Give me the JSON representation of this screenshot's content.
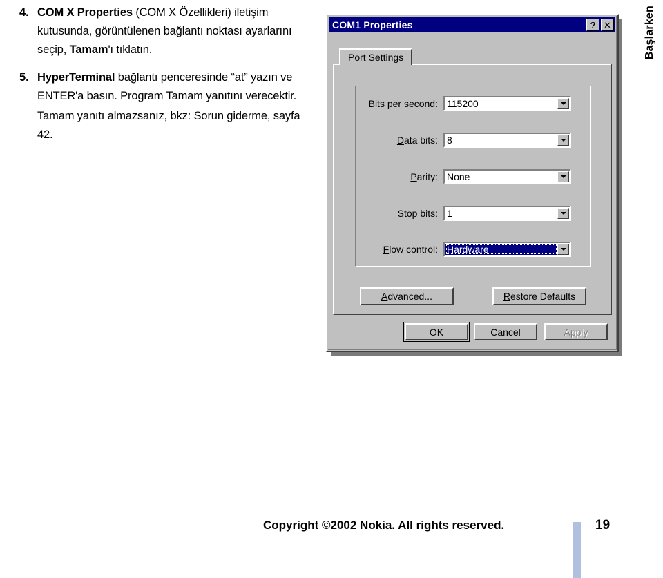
{
  "document": {
    "side_tab_label": "Başlarken",
    "steps": [
      {
        "number": "4.",
        "segments": [
          {
            "text": "COM X Properties",
            "bold": true
          },
          {
            "text": " (COM X Özellikleri) iletişim kutusunda, görüntülenen bağlantı noktası ayarlarını seçip, ",
            "bold": false
          },
          {
            "text": "Tamam",
            "bold": true
          },
          {
            "text": "'ı tıklatın.",
            "bold": false
          }
        ]
      },
      {
        "number": "5.",
        "segments": [
          {
            "text": "HyperTerminal",
            "bold": true
          },
          {
            "text": " bağlantı penceresinde “at” yazın ve ENTER'a basın. Program Tamam yanıtını verecektir.",
            "bold": false
          }
        ],
        "sub_paragraph": "Tamam yanıtı almazsanız, bkz: Sorun giderme, sayfa 42."
      }
    ]
  },
  "dialog": {
    "title": "COM1 Properties",
    "titlebar_buttons": [
      {
        "name": "help-button",
        "glyph": "?"
      },
      {
        "name": "close-button",
        "glyph": "✕"
      }
    ],
    "tabs": [
      {
        "label": "Port Settings",
        "active": true
      }
    ],
    "fields": [
      {
        "label_prefix": "",
        "label_accel": "B",
        "label_rest": "its per second:",
        "value": "115200",
        "selected": false
      },
      {
        "label_prefix": "",
        "label_accel": "D",
        "label_rest": "ata bits:",
        "value": "8",
        "selected": false
      },
      {
        "label_prefix": "",
        "label_accel": "P",
        "label_rest": "arity:",
        "value": "None",
        "selected": false
      },
      {
        "label_prefix": "",
        "label_accel": "S",
        "label_rest": "top bits:",
        "value": "1",
        "selected": false
      },
      {
        "label_prefix": "",
        "label_accel": "F",
        "label_rest": "low control:",
        "value": "Hardware",
        "selected": true
      }
    ],
    "page_buttons": {
      "advanced": {
        "accel": "A",
        "prefix": "",
        "rest": "dvanced..."
      },
      "restore": {
        "accel": "R",
        "prefix": "",
        "rest": "estore Defaults"
      }
    },
    "footer_buttons": {
      "ok": "OK",
      "cancel": "Cancel",
      "apply": "Apply",
      "apply_disabled": true
    },
    "colors": {
      "titlebar": "#000080",
      "face": "#c0c0c0",
      "selection": "#000080",
      "disabled_text": "#808080"
    }
  },
  "footer": {
    "copyright": "Copyright ©2002 Nokia. All rights reserved.",
    "page_number": "19",
    "bar_color": "#b2bfe0"
  }
}
